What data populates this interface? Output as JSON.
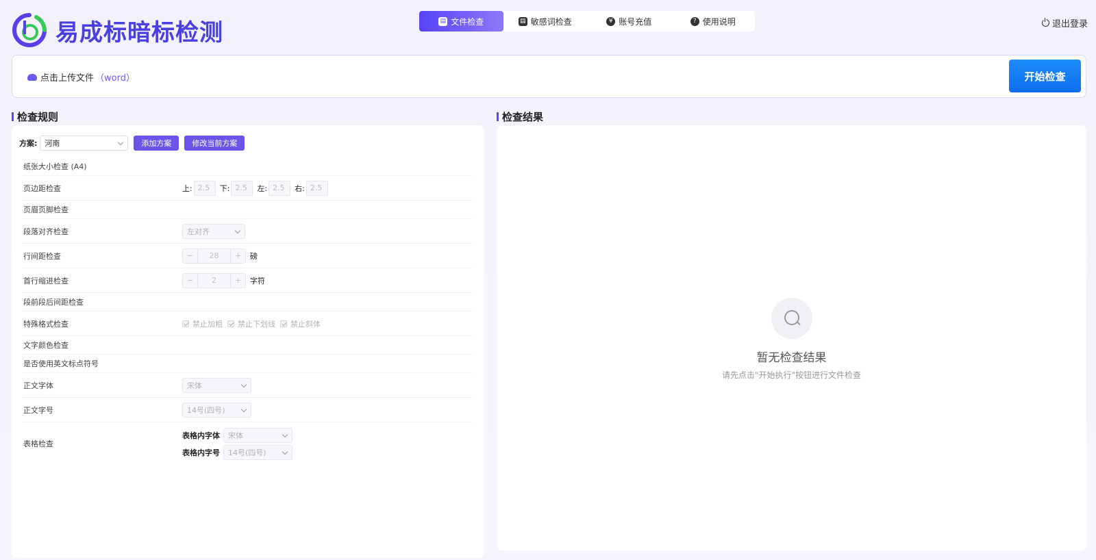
{
  "brand": {
    "title": "易成标暗标检测"
  },
  "nav": {
    "tabs": [
      {
        "label": "文件检查",
        "icon": "document-check-icon",
        "active": true
      },
      {
        "label": "敏感词检查",
        "icon": "sensitive-word-icon",
        "active": false
      },
      {
        "label": "账号充值",
        "icon": "recharge-icon",
        "active": false
      },
      {
        "label": "使用说明",
        "icon": "help-icon",
        "active": false
      }
    ]
  },
  "logout_label": "退出登录",
  "upload": {
    "label": "点击上传文件",
    "ext": "（word）",
    "start_label": "开始检查"
  },
  "left": {
    "title": "检查规则",
    "scheme_label": "方案:",
    "scheme_value": "河南",
    "add_label": "添加方案",
    "edit_label": "修改当前方案",
    "rules": {
      "paper": "纸张大小检查 (A4)",
      "margin": "页边距检查",
      "margin_top_label": "上:",
      "margin_top": "2.5",
      "margin_bottom_label": "下:",
      "margin_bottom": "2.5",
      "margin_left_label": "左:",
      "margin_left": "2.5",
      "margin_right_label": "右:",
      "margin_right": "2.5",
      "header_footer": "页眉页脚检查",
      "align": "段落对齐检查",
      "align_value": "左对齐",
      "line_spacing": "行间距检查",
      "line_spacing_value": "28",
      "line_spacing_unit": "磅",
      "indent": "首行缩进检查",
      "indent_value": "2",
      "indent_unit": "字符",
      "para_spacing": "段前段后间距检查",
      "special": "特殊格式检查",
      "no_bold": "禁止加粗",
      "no_underline": "禁止下划线",
      "no_italic": "禁止斜体",
      "text_color": "文字颜色检查",
      "en_punct": "是否使用英文标点符号",
      "body_font": "正文字体",
      "body_font_value": "宋体",
      "body_size": "正文字号",
      "body_size_value": "14号(四号)",
      "table": "表格检查",
      "table_font_label": "表格内字体",
      "table_font_value": "宋体",
      "table_size_label": "表格内字号",
      "table_size_value": "14号(四号)"
    },
    "stepper_minus": "−",
    "stepper_plus": "+"
  },
  "right": {
    "title": "检查结果",
    "empty_title": "暂无检查结果",
    "empty_desc": "请先点击\"开始执行\"按钮进行文件检查"
  },
  "colors": {
    "accent": "#5a4af0",
    "primary_button": "#1d8cf8"
  }
}
